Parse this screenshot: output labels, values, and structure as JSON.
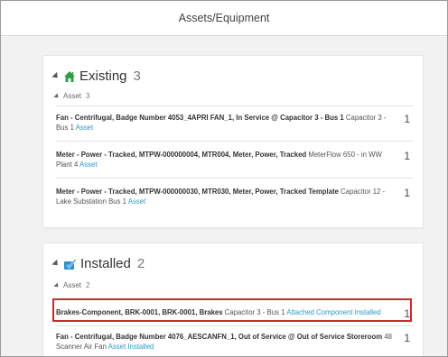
{
  "header": {
    "title": "Assets/Equipment"
  },
  "existing": {
    "title": "Existing",
    "count": "3",
    "icon": "home-icon",
    "icon_color": "#2f9e44",
    "group": {
      "label": "Asset",
      "count": "3"
    },
    "items": [
      {
        "bold": "Fan - Centrifugal, Badge Number 4053_4APRI FAN_1, In Service @ Capacitor 3 - Bus 1",
        "plain": " Capacitor 3 - Bus 1 ",
        "link": "Asset",
        "qty": "1"
      },
      {
        "bold": "Meter - Power - Tracked, MTPW-000000004, MTR004, Meter, Power, Tracked",
        "plain": " MeterFlow 650 - in WW Plant 4 ",
        "link": "Asset",
        "qty": "1"
      },
      {
        "bold": "Meter - Power - Tracked, MTPW-000000030, MTR030, Meter, Power, Tracked Template",
        "plain": " Capacitor 12 - Lake Substation Bus 1 ",
        "link": "Asset",
        "qty": "1"
      }
    ]
  },
  "installed": {
    "title": "Installed",
    "count": "2",
    "icon": "install-icon",
    "icon_color": "#2f8ecf",
    "group": {
      "label": "Asset",
      "count": "2"
    },
    "items": [
      {
        "bold": "Brakes-Component, BRK-0001, BRK-0001, Brakes",
        "plain": " Capacitor 3 - Bus 1 ",
        "link": "Attached Component Installed",
        "qty": "1"
      },
      {
        "bold": "Fan - Centrifugal, Badge Number 4076_AESCANFN_1, Out of Service @ Out of Service Storeroom",
        "plain": " 48 Scanner Air Fan ",
        "link": "Asset Installed",
        "qty": "1"
      }
    ]
  },
  "colors": {
    "highlight": "#d0282e",
    "link": "#2a9ac9"
  }
}
